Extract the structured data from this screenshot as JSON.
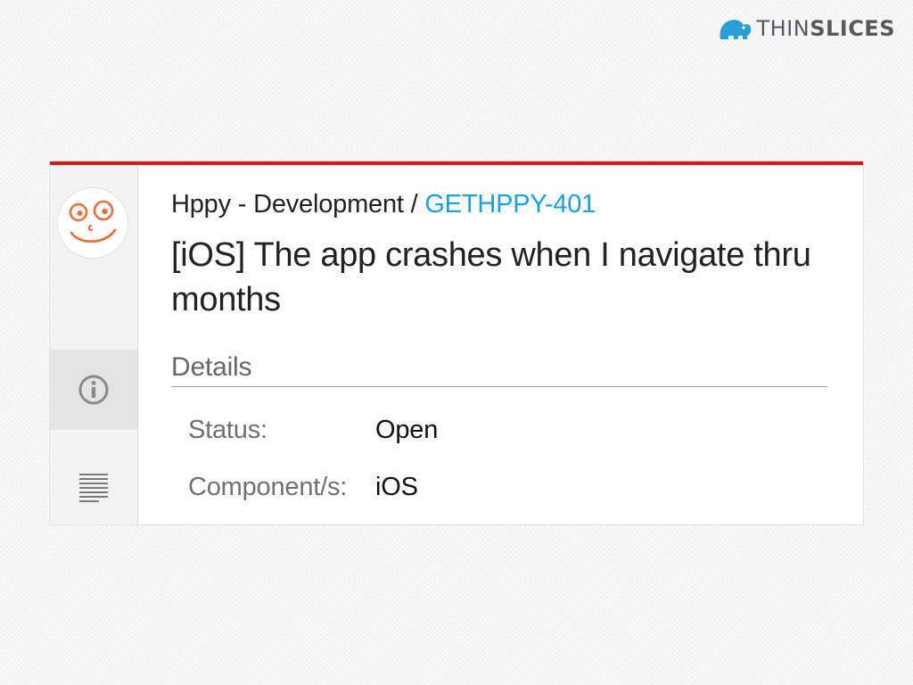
{
  "brand": {
    "name_part1": "THIN",
    "name_part2": "SLICES",
    "icon": "elephant-logo-icon",
    "color": "#55595e",
    "accent": "#2a9fd6"
  },
  "issue": {
    "project": "Hppy - Development",
    "separator": " / ",
    "key": "GETHPPY-401",
    "title": "[iOS] The app crashes when I navigate thru months",
    "accent_color": "#d7181f",
    "link_color": "#1aa1e1"
  },
  "sidebar": {
    "avatar_icon": "smiley-avatar-icon",
    "items": [
      {
        "icon": "info-icon",
        "active": true
      },
      {
        "icon": "description-lines-icon",
        "active": false
      }
    ]
  },
  "details": {
    "heading": "Details",
    "fields": [
      {
        "label": "Status:",
        "value": "Open"
      },
      {
        "label": "Component/s:",
        "value": "iOS"
      }
    ]
  }
}
